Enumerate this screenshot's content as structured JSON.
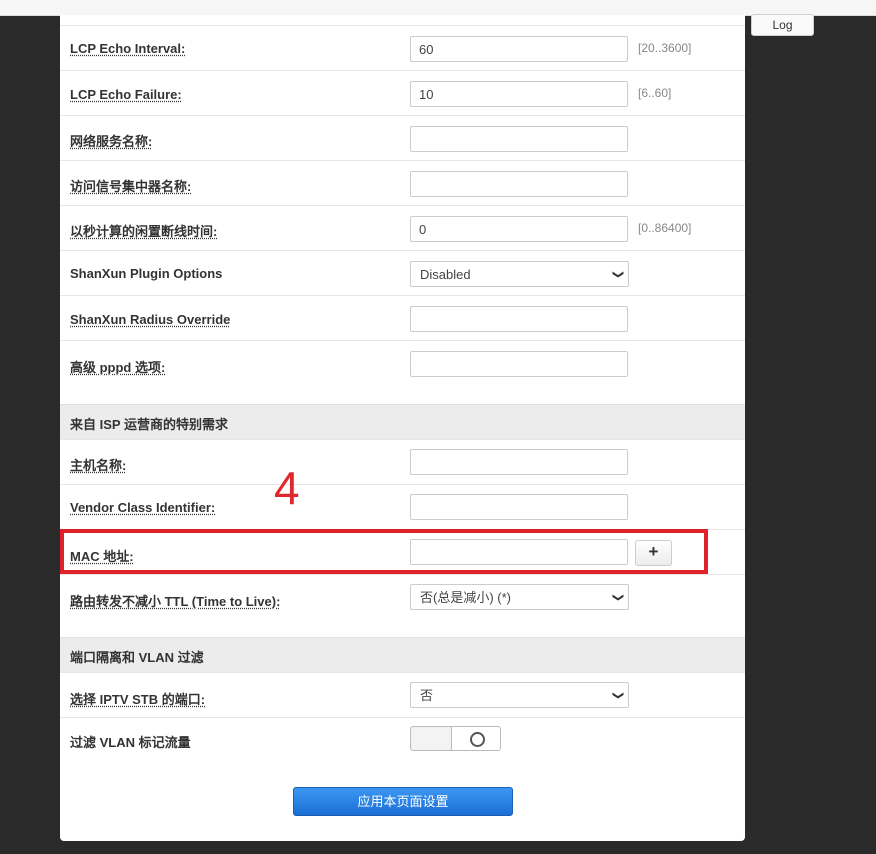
{
  "header": {
    "log_button": "Log"
  },
  "settings": {
    "lcp_interval": {
      "label": "LCP Echo Interval:",
      "value": "60",
      "hint": "[20..3600]"
    },
    "lcp_failure": {
      "label": "LCP Echo Failure:",
      "value": "10",
      "hint": "[6..60]"
    },
    "service_name": {
      "label": "网络服务名称:",
      "value": ""
    },
    "concentrator": {
      "label": "访问信号集中器名称:",
      "value": ""
    },
    "idle_timeout": {
      "label": "以秒计算的闲置断线时间:",
      "value": "0",
      "hint": "[0..86400]"
    },
    "shanxun_plugin": {
      "label": "ShanXun Plugin Options",
      "value": "Disabled"
    },
    "shanxun_radius": {
      "label": "ShanXun Radius Override",
      "value": ""
    },
    "pppd_options": {
      "label": "高级 pppd 选项:",
      "value": ""
    }
  },
  "isp": {
    "title": "来自 ISP 运营商的特别需求",
    "hostname": {
      "label": "主机名称:",
      "value": ""
    },
    "vendor_class": {
      "label": "Vendor Class Identifier:",
      "value": ""
    },
    "mac": {
      "label": "MAC 地址:",
      "value": "",
      "add_glyph": "+"
    },
    "ttl": {
      "label": "路由转发不减小 TTL (Time to Live):",
      "value": "否(总是减小) (*)"
    }
  },
  "vlan": {
    "title": "端口隔离和 VLAN 过滤",
    "iptv": {
      "label": "选择 IPTV STB 的端口:",
      "value": "否"
    },
    "filter": {
      "label": "过滤 VLAN 标记流量",
      "enabled": false
    }
  },
  "apply_button": "应用本页面设置",
  "annotation": {
    "number": "4",
    "color": "#e0222a"
  },
  "colors": {
    "accent": "#1b6fd6",
    "section_bg": "#ececec",
    "annotation": "#e0222a"
  },
  "icons": {
    "dropdown": "chevron-down-icon",
    "toggle": "circle-icon"
  }
}
